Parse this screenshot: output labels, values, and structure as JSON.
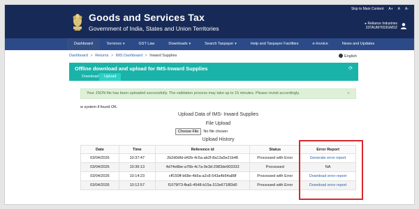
{
  "header": {
    "utility_links": [
      "Skip to Main Content",
      "A+",
      "A",
      "A-"
    ],
    "title": "Goods and Services Tax",
    "subtitle": "Government of India, States and Union Territories",
    "user_name": "Reliance Industries",
    "user_gstin": "33TAUM7653GMDZ"
  },
  "nav": {
    "items": [
      {
        "label": "Dashboard",
        "caret": ""
      },
      {
        "label": "Services",
        "caret": "▾"
      },
      {
        "label": "GST Law",
        "caret": ""
      },
      {
        "label": "Downloads",
        "caret": "▾"
      },
      {
        "label": "Search Taxpayer",
        "caret": "▾"
      },
      {
        "label": "Help and Taxpayer Facilities",
        "caret": ""
      },
      {
        "label": "e-Invoice",
        "caret": ""
      },
      {
        "label": "News and Updates",
        "caret": ""
      }
    ]
  },
  "breadcrumb": {
    "items": [
      "Dashboard",
      "Returns",
      "IMS Dashboard"
    ],
    "current": "Inward Supplies",
    "separator": ">"
  },
  "language": "English",
  "panel": {
    "title": "Offline download and upload for IMS-Inward Supplies",
    "refresh_icon": "refresh-icon",
    "tabs": [
      "Download",
      "Upload"
    ],
    "active_tab": "Upload"
  },
  "alert": {
    "message": "Your JSON file has been uploaded successfully. The validation process may take up to 15 minutes. Please revisit accordingly.",
    "close": "×"
  },
  "system_message": "w system if found OK.",
  "upload_section": {
    "title": "Upload Data of IMS- Inward Supplies",
    "file_upload_label": "File Upload",
    "choose_button": "Choose File",
    "no_file": "No file chosen"
  },
  "history": {
    "title": "Upload History",
    "columns": [
      "Date",
      "Time",
      "Reference id",
      "Status",
      "Error Report"
    ],
    "rows": [
      {
        "date": "03/04/2026",
        "time": "10:37:47",
        "ref": "2b2d0dfd-d42b-4c5a-ab2f-8a13a5e21b48",
        "status": "Processed with Error",
        "report": "Generate error report",
        "is_link": true
      },
      {
        "date": "03/04/2026",
        "time": "10:36:13",
        "ref": "4d74e8be-a76b-4c7a-9e3d-2983de903333",
        "status": "Processed",
        "report": "NA",
        "is_link": false
      },
      {
        "date": "03/04/2026",
        "time": "10:14:23",
        "ref": "cff150ff-b68e-4b5a-a2c8-543a4b54a88f",
        "status": "Processed with Error",
        "report": "Download error report",
        "is_link": true
      },
      {
        "date": "03/04/2026",
        "time": "10:12:57",
        "ref": "f1079f73-fba5-4548-b15a-313e671f83d0",
        "status": "Processed with Error",
        "report": "Download error report",
        "is_link": true
      }
    ]
  },
  "colors": {
    "header_bg": "#172a57",
    "nav_bg": "#2b4a87",
    "panel_teal": "#19b3a9",
    "highlight_red": "#d9262c",
    "link": "#2a62a8"
  }
}
